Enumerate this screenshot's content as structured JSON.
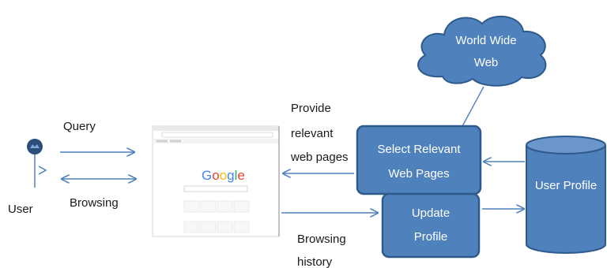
{
  "diagram": {
    "user_label": "User",
    "query_label": "Query",
    "browsing_label": "Browsing",
    "provide_line1": "Provide",
    "provide_line2": "relevant",
    "provide_line3": "web pages",
    "browsing_history_line1": "Browsing",
    "browsing_history_line2": "history",
    "www_line1": "World Wide",
    "www_line2": "Web",
    "select_line1": "Select Relevant",
    "select_line2": "Web Pages",
    "update_line1": "Update",
    "update_line2": "Profile",
    "user_profile_label": "User Profile",
    "browser_logo": "Google"
  },
  "colors": {
    "box_fill": "#4f81bd",
    "box_stroke": "#2e5a8c",
    "arrow": "#4f81bd",
    "text": "#1a1a1a"
  }
}
